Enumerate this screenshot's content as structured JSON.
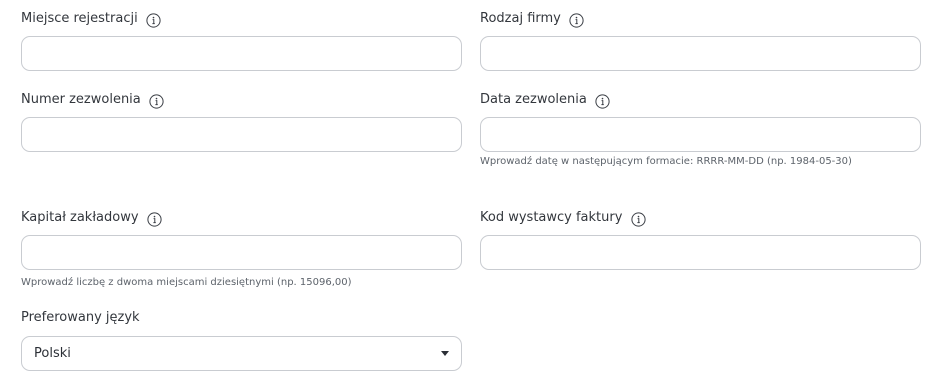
{
  "fields": {
    "registration_place": {
      "label": "Miejsce rejestracji",
      "value": ""
    },
    "company_type": {
      "label": "Rodzaj firmy",
      "value": ""
    },
    "permit_number": {
      "label": "Numer zezwolenia",
      "value": ""
    },
    "permit_date": {
      "label": "Data zezwolenia",
      "value": "",
      "hint": "Wprowadź datę w następującym formacie: RRRR-MM-DD (np. 1984-05-30)"
    },
    "share_capital": {
      "label": "Kapitał zakładowy",
      "value": "",
      "hint": "Wprowadź liczbę z dwoma miejscami dziesiętnymi (np. 15096,00)"
    },
    "invoice_issuer_code": {
      "label": "Kod wystawcy faktury",
      "value": ""
    },
    "preferred_language": {
      "label": "Preferowany język",
      "selected": "Polski"
    }
  },
  "icons": {
    "info": "info-circle-icon",
    "dropdown": "caret-down-icon"
  },
  "colors": {
    "border": "#c9ccd1",
    "text": "#2b2f36",
    "hint": "#5d636b"
  }
}
